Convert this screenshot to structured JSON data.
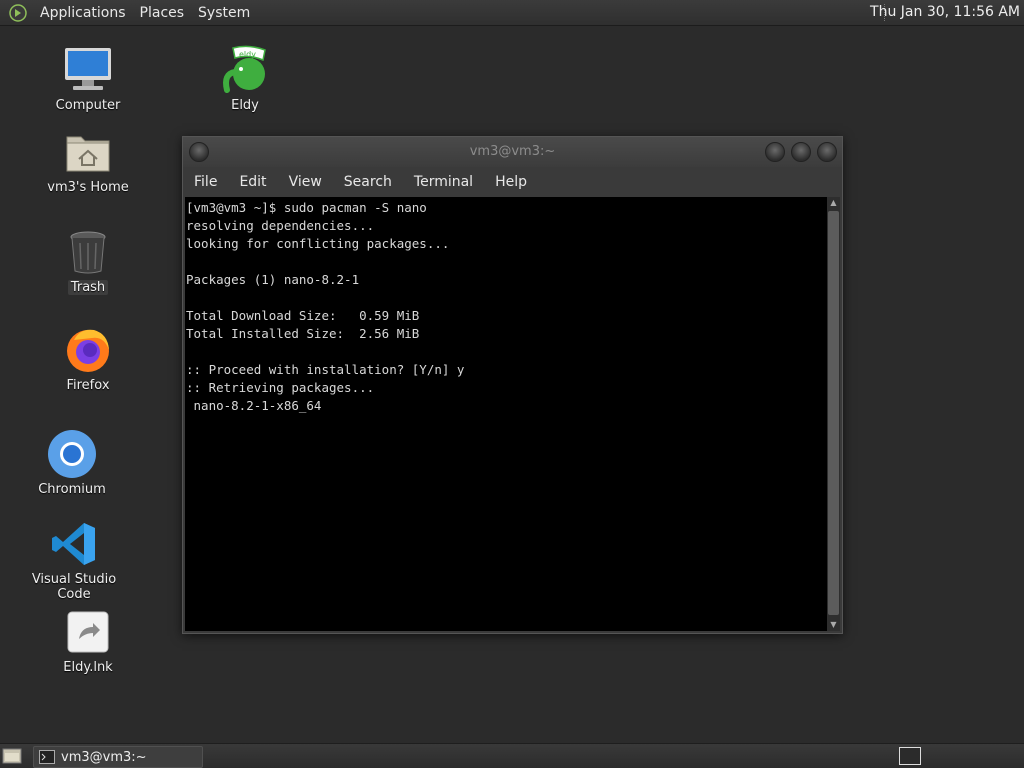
{
  "top_panel": {
    "menus": [
      "Applications",
      "Places",
      "System"
    ],
    "clock": "Thu Jan 30, 11:56 AM"
  },
  "desktop_icons": {
    "computer": "Computer",
    "eldy": "Eldy",
    "home": "vm3's Home",
    "trash": "Trash",
    "firefox": "Firefox",
    "chromium": "Chromium",
    "vscode": "Visual Studio Code",
    "eldy_lnk": "Eldy.lnk"
  },
  "terminal": {
    "title": "vm3@vm3:~",
    "menu": [
      "File",
      "Edit",
      "View",
      "Search",
      "Terminal",
      "Help"
    ],
    "output": "[vm3@vm3 ~]$ sudo pacman -S nano\nresolving dependencies...\nlooking for conflicting packages...\n\nPackages (1) nano-8.2-1\n\nTotal Download Size:   0.59 MiB\nTotal Installed Size:  2.56 MiB\n\n:: Proceed with installation? [Y/n] y\n:: Retrieving packages...\n nano-8.2-1-x86_64"
  },
  "taskbar": {
    "window_label": "vm3@vm3:~"
  },
  "colors": {
    "desktop_bg": "#2b2b2b",
    "terminal_bg": "#000000",
    "terminal_fg": "#d8d8d8"
  }
}
